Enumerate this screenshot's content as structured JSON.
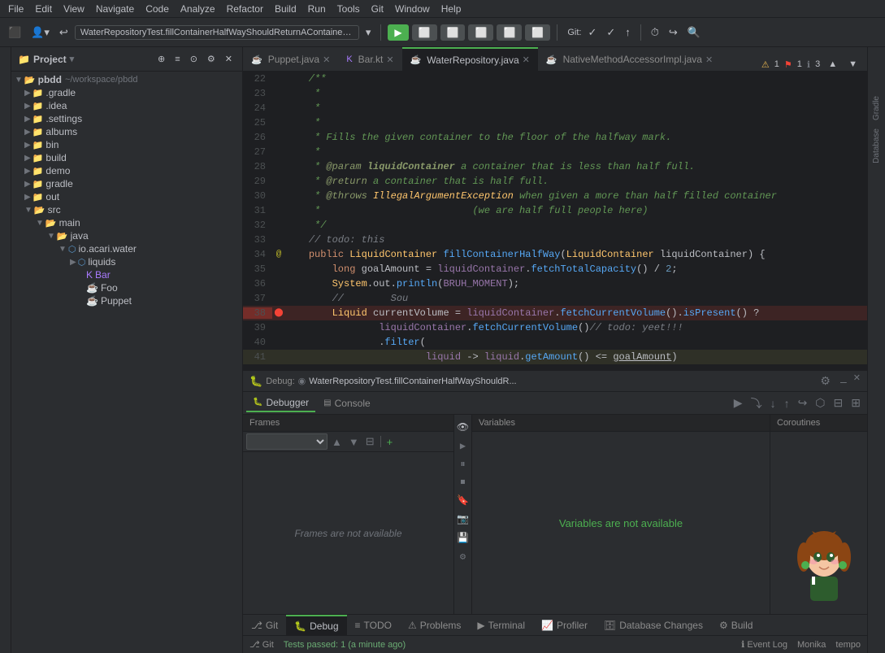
{
  "menu": {
    "items": [
      "File",
      "Edit",
      "View",
      "Navigate",
      "Code",
      "Analyze",
      "Refactor",
      "Build",
      "Run",
      "Tools",
      "Git",
      "Window",
      "Help"
    ]
  },
  "toolbar": {
    "breadcrumb": "WaterRepositoryTest.fillContainerHalfWayShouldReturnAContainerThatIsHalfFull",
    "git_label": "Git:"
  },
  "tabs": [
    {
      "label": "Puppet.java",
      "type": "java",
      "active": false
    },
    {
      "label": "Bar.kt",
      "type": "kt",
      "active": false
    },
    {
      "label": "WaterRepository.java",
      "type": "java",
      "active": true
    },
    {
      "label": "NativeMethodAccessorImpl.java",
      "type": "java",
      "active": false
    }
  ],
  "project": {
    "title": "Project",
    "root": "pbdd",
    "root_path": "~/workspace/pbdd",
    "tree": [
      {
        "label": ".gradle",
        "type": "folder",
        "indent": 1,
        "expanded": false
      },
      {
        "label": ".idea",
        "type": "folder",
        "indent": 1,
        "expanded": false
      },
      {
        "label": ".settings",
        "type": "folder",
        "indent": 1,
        "expanded": false
      },
      {
        "label": "albums",
        "type": "folder",
        "indent": 1,
        "expanded": false
      },
      {
        "label": "bin",
        "type": "folder",
        "indent": 1,
        "expanded": false
      },
      {
        "label": "build",
        "type": "folder",
        "indent": 1,
        "expanded": false
      },
      {
        "label": "demo",
        "type": "folder",
        "indent": 1,
        "expanded": false
      },
      {
        "label": "gradle",
        "type": "folder",
        "indent": 1,
        "expanded": false
      },
      {
        "label": "out",
        "type": "folder",
        "indent": 1,
        "expanded": false
      },
      {
        "label": "src",
        "type": "folder",
        "indent": 1,
        "expanded": true
      },
      {
        "label": "main",
        "type": "folder",
        "indent": 2,
        "expanded": true
      },
      {
        "label": "java",
        "type": "folder",
        "indent": 3,
        "expanded": true
      },
      {
        "label": "io.acari.water",
        "type": "package",
        "indent": 4,
        "expanded": true
      },
      {
        "label": "liquids",
        "type": "package",
        "indent": 5,
        "expanded": false
      },
      {
        "label": "Bar",
        "type": "kt",
        "indent": 5
      },
      {
        "label": "Foo",
        "type": "java",
        "indent": 5
      },
      {
        "label": "Puppet",
        "type": "java",
        "indent": 5
      }
    ]
  },
  "editor": {
    "warning_count": "1",
    "error_count": "1",
    "info_count": "3",
    "lines": [
      {
        "num": "22",
        "code": "    /**",
        "type": "javadoc"
      },
      {
        "num": "23",
        "code": "     *",
        "type": "javadoc"
      },
      {
        "num": "24",
        "code": "     *",
        "type": "javadoc"
      },
      {
        "num": "25",
        "code": "     *",
        "type": "javadoc"
      },
      {
        "num": "26",
        "code": "     * Fills the given container to the floor of the halfway mark.",
        "type": "javadoc"
      },
      {
        "num": "27",
        "code": "     *",
        "type": "javadoc"
      },
      {
        "num": "28",
        "code": "     * @param liquidContainer a container that is less than half full.",
        "type": "javadoc"
      },
      {
        "num": "29",
        "code": "     * @return a container that is half full.",
        "type": "javadoc"
      },
      {
        "num": "30",
        "code": "     * @throws IllegalArgumentException when given a more than half filled container",
        "type": "javadoc"
      },
      {
        "num": "31",
        "code": "     *                          (we are half full people here)",
        "type": "javadoc"
      },
      {
        "num": "32",
        "code": "     */",
        "type": "javadoc"
      },
      {
        "num": "33",
        "code": "    // todo: this",
        "type": "comment"
      },
      {
        "num": "34",
        "code": "@    public LiquidContainer fillContainerHalfWay(LiquidContainer liquidContainer) {",
        "type": "code"
      },
      {
        "num": "35",
        "code": "        long goalAmount = liquidContainer.fetchTotalCapacity() / 2;",
        "type": "code"
      },
      {
        "num": "36",
        "code": "        System.out.println(BRUH_MOMENT);",
        "type": "code"
      },
      {
        "num": "37",
        "code": "//        Sou",
        "type": "comment"
      },
      {
        "num": "38",
        "code": "        Liquid currentVolume = liquidContainer.fetchCurrentVolume().isPresent() ?",
        "type": "code_bp"
      },
      {
        "num": "39",
        "code": "                liquidContainer.fetchCurrentVolume()// todo: yeet!!!",
        "type": "code"
      },
      {
        "num": "40",
        "code": "                .filter(",
        "type": "code"
      },
      {
        "num": "41",
        "code": "                        liquid -> liquid.getAmount() <= goalAmount)",
        "type": "code"
      }
    ]
  },
  "debug": {
    "label": "Debug:",
    "breadcrumb": "WaterRepositoryTest.fillContainerHalfWayShouldR...",
    "tabs": [
      "Debugger",
      "Console"
    ],
    "active_tab": "Debugger",
    "sections": {
      "frames": "Frames",
      "variables": "Variables",
      "coroutines": "Coroutines"
    },
    "frames_message": "Frames are not available",
    "variables_message": "Variables are not available"
  },
  "bottom_tabs": [
    {
      "label": "Git",
      "icon": "git"
    },
    {
      "label": "Debug",
      "icon": "debug",
      "active": true
    },
    {
      "label": "TODO",
      "icon": "todo"
    },
    {
      "label": "Problems",
      "icon": "problems"
    },
    {
      "label": "Terminal",
      "icon": "terminal"
    },
    {
      "label": "Profiler",
      "icon": "profiler"
    },
    {
      "label": "Database Changes",
      "icon": "db"
    },
    {
      "label": "Build",
      "icon": "build"
    }
  ],
  "status_bar": {
    "test_result": "Tests passed: 1 (a minute ago)",
    "monika_label": "Monika",
    "tempo_label": "tempo"
  },
  "right_sidebar": {
    "items": [
      "Gradle",
      "Database"
    ]
  }
}
